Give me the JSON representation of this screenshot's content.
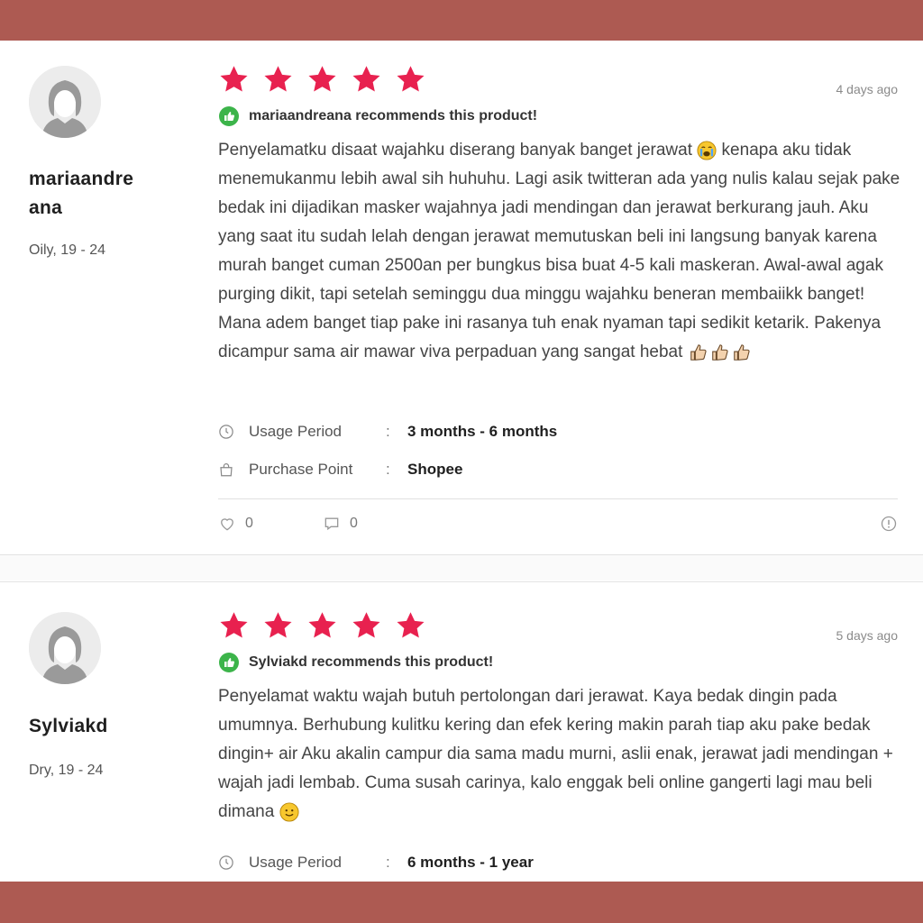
{
  "colors": {
    "star": "#e8214f",
    "recommend": "#3cb44a",
    "band": "#ad5a52"
  },
  "reviews": [
    {
      "username": "mariaandreana",
      "username_line1": "mariaandre",
      "username_line2": "ana",
      "profile": "Oily, 19 - 24",
      "rating": 5,
      "date": "4 days ago",
      "recommend_text": "mariaandreana recommends this product!",
      "text": "Penyelamatku disaat wajahku diserang banyak banget jerawat",
      "emoji_after_text": "crying-face",
      "text_continued": " kenapa aku tidak menemukanmu lebih awal sih huhuhu. Lagi asik twitteran ada yang nulis kalau sejak pake bedak ini dijadikan masker wajahnya jadi mendingan dan jerawat berkurang jauh. Aku yang saat itu sudah lelah dengan jerawat memutuskan beli ini langsung banyak karena murah banget cuman 2500an per bungkus bisa buat 4-5 kali maskeran. Awal-awal agak purging dikit, tapi setelah seminggu dua minggu wajahku beneran membaiikk banget! Mana adem banget tiap pake ini rasanya tuh enak nyaman tapi sedikit ketarik. Pakenya dicampur sama air mawar viva perpaduan yang sangat hebat ",
      "trailing_emoji": "thumbs-up x3",
      "usage_label": "Usage Period",
      "usage_value": "3 months - 6 months",
      "purchase_label": "Purchase Point",
      "purchase_value": "Shopee",
      "likes": "0",
      "comments": "0",
      "icons": [
        "heart-icon",
        "comment-icon",
        "report-icon",
        "clock-icon",
        "shopping-bag-icon"
      ]
    },
    {
      "username": "Sylviakd",
      "profile": "Dry, 19 - 24",
      "rating": 5,
      "date": "5 days ago",
      "recommend_text": "Sylviakd recommends this product!",
      "text": "Penyelamat waktu wajah butuh pertolongan dari jerawat. Kaya bedak dingin pada umumnya. Berhubung kulitku kering dan efek kering makin parah tiap aku pake bedak dingin+ air Aku akalin campur dia sama madu murni, aslii enak, jerawat jadi mendingan + wajah jadi lembab. Cuma susah carinya, kalo enggak beli online gangerti lagi mau beli dimana ",
      "trailing_emoji": "slightly-smiling-face",
      "usage_label": "Usage Period",
      "usage_value": "6 months - 1 year"
    }
  ],
  "separator": ":"
}
